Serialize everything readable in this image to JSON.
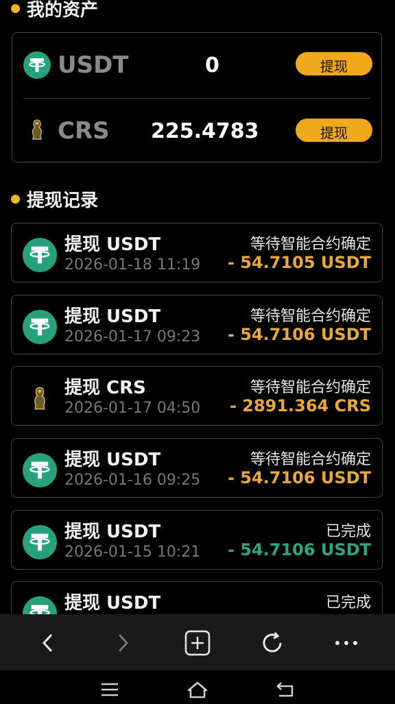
{
  "assets": {
    "title": "我的资产",
    "items": [
      {
        "symbol": "USDT",
        "amount": "0",
        "button_label": "提现",
        "icon": "usdt-icon"
      },
      {
        "symbol": "CRS",
        "amount": "225.4783",
        "button_label": "提现",
        "icon": "crs-icon"
      }
    ]
  },
  "records": {
    "title": "提现记录",
    "items": [
      {
        "title": "提现 USDT",
        "date": "2026-01-18 11:19",
        "status": "等待智能合约确定",
        "amount": "- 54.7105 USDT",
        "state": "pending",
        "icon": "usdt-icon"
      },
      {
        "title": "提现 USDT",
        "date": "2026-01-17 09:23",
        "status": "等待智能合约确定",
        "amount": "- 54.7106 USDT",
        "state": "pending",
        "icon": "usdt-icon"
      },
      {
        "title": "提现 CRS",
        "date": "2026-01-17 04:50",
        "status": "等待智能合约确定",
        "amount": "- 2891.364 CRS",
        "state": "pending",
        "icon": "crs-icon"
      },
      {
        "title": "提现 USDT",
        "date": "2026-01-16 09:25",
        "status": "等待智能合约确定",
        "amount": "- 54.7106 USDT",
        "state": "pending",
        "icon": "usdt-icon"
      },
      {
        "title": "提现 USDT",
        "date": "2026-01-15 10:21",
        "status": "已完成",
        "amount": "- 54.7106 USDT",
        "state": "done",
        "icon": "usdt-icon"
      },
      {
        "title": "提现 USDT",
        "date": "",
        "status": "已完成",
        "amount": "",
        "state": "done",
        "icon": "usdt-icon"
      }
    ]
  },
  "toolbar": {
    "icons": [
      "back-icon",
      "forward-icon",
      "new-tab-icon",
      "refresh-icon",
      "more-icon"
    ]
  },
  "navbar": {
    "icons": [
      "menu-icon",
      "home-icon",
      "return-icon"
    ]
  },
  "colors": {
    "accent": "#f0a91a",
    "usdt": "#26a17b",
    "pending_amount": "#e8a83a",
    "done_amount": "#2fa57f"
  }
}
